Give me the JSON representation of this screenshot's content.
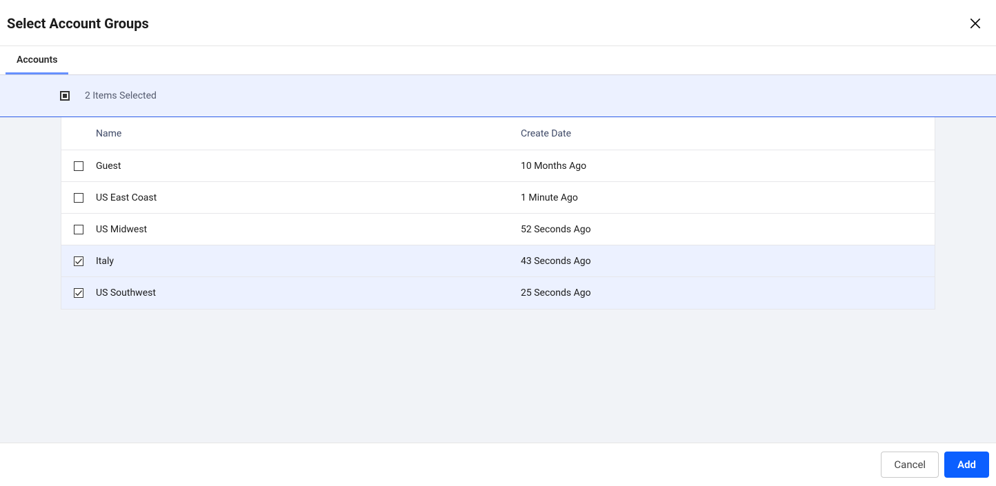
{
  "header": {
    "title": "Select Account Groups"
  },
  "tabs": [
    {
      "label": "Accounts",
      "active": true
    }
  ],
  "selection_bar": {
    "text": "2 Items Selected"
  },
  "table": {
    "columns": {
      "name": "Name",
      "create_date": "Create Date"
    },
    "rows": [
      {
        "name": "Guest",
        "create_date": "10 Months Ago",
        "selected": false
      },
      {
        "name": "US East Coast",
        "create_date": "1 Minute Ago",
        "selected": false
      },
      {
        "name": "US Midwest",
        "create_date": "52 Seconds Ago",
        "selected": false
      },
      {
        "name": "Italy",
        "create_date": "43 Seconds Ago",
        "selected": true
      },
      {
        "name": "US Southwest",
        "create_date": "25 Seconds Ago",
        "selected": true
      }
    ]
  },
  "footer": {
    "cancel": "Cancel",
    "add": "Add"
  }
}
